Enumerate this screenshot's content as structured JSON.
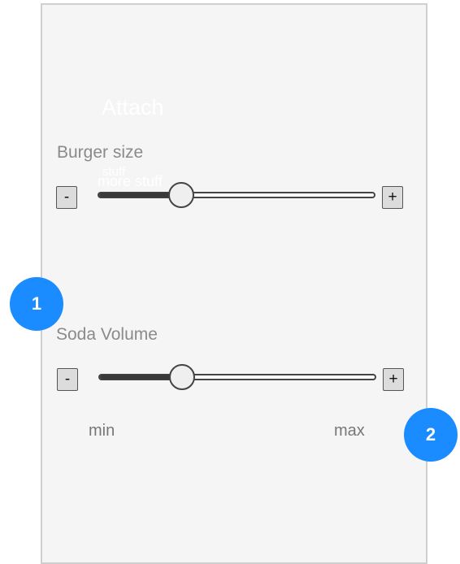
{
  "overlay": {
    "attach": "Attach",
    "stuff": "stuff",
    "more_stuff": "more stuff"
  },
  "burger_slider": {
    "label": "Burger size",
    "minus": "-",
    "plus": "+",
    "value_fraction": 0.3
  },
  "soda_slider": {
    "label": "Soda Volume",
    "minus": "-",
    "plus": "+",
    "value_fraction": 0.3,
    "min_label": "min",
    "max_label": "max"
  },
  "badges": [
    "1",
    "2"
  ],
  "colors": {
    "accent": "#1a8cff",
    "panel": "#f5f5f5",
    "label": "#8a8a8a"
  }
}
